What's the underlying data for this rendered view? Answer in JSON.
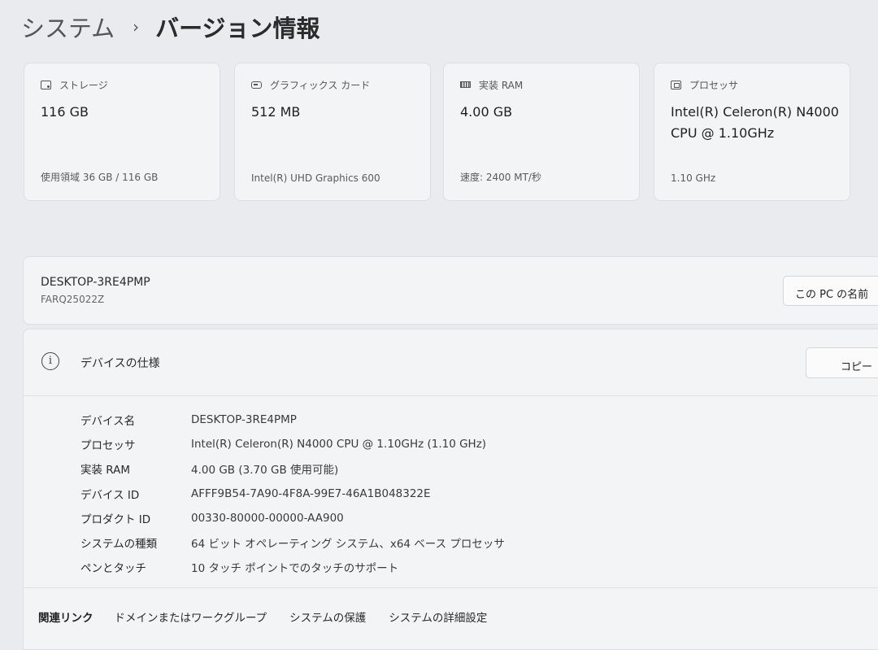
{
  "breadcrumb": {
    "parent": "システム",
    "separator": "›",
    "current": "バージョン情報"
  },
  "cards": [
    {
      "icon": "storage-icon",
      "title": "ストレージ",
      "value": "116 GB",
      "detail": "使用領域 36 GB / 116 GB"
    },
    {
      "icon": "graphics-card-icon",
      "title": "グラフィックス カード",
      "value": "512 MB",
      "detail": "Intel(R) UHD Graphics 600"
    },
    {
      "icon": "ram-icon",
      "title": "実装 RAM",
      "value": "4.00 GB",
      "detail": "速度: 2400 MT/秒"
    },
    {
      "icon": "processor-icon",
      "title": "プロセッサ",
      "value": "Intel(R) Celeron(R) N4000 CPU @ 1.10GHz",
      "detail": "1.10 GHz"
    }
  ],
  "pc": {
    "name": "DESKTOP-3RE4PMP",
    "model": "FARQ25022Z",
    "rename_label": "この PC の名前"
  },
  "specs": {
    "title": "デバイスの仕様",
    "copy_label": "コピー",
    "rows": [
      {
        "label": "デバイス名",
        "value": "DESKTOP-3RE4PMP"
      },
      {
        "label": "プロセッサ",
        "value": "Intel(R) Celeron(R) N4000 CPU @ 1.10GHz (1.10 GHz)"
      },
      {
        "label": "実装 RAM",
        "value": "4.00 GB (3.70 GB 使用可能)"
      },
      {
        "label": "デバイス ID",
        "value": "AFFF9B54-7A90-4F8A-99E7-46A1B048322E"
      },
      {
        "label": "プロダクト ID",
        "value": "00330-80000-00000-AA900"
      },
      {
        "label": "システムの種類",
        "value": "64 ビット オペレーティング システム、x64 ベース プロセッサ"
      },
      {
        "label": "ペンとタッチ",
        "value": "10 タッチ ポイントでのタッチのサポート"
      }
    ]
  },
  "related": {
    "label": "関連リンク",
    "links": [
      "ドメインまたはワークグループ",
      "システムの保護",
      "システムの詳細設定"
    ]
  }
}
